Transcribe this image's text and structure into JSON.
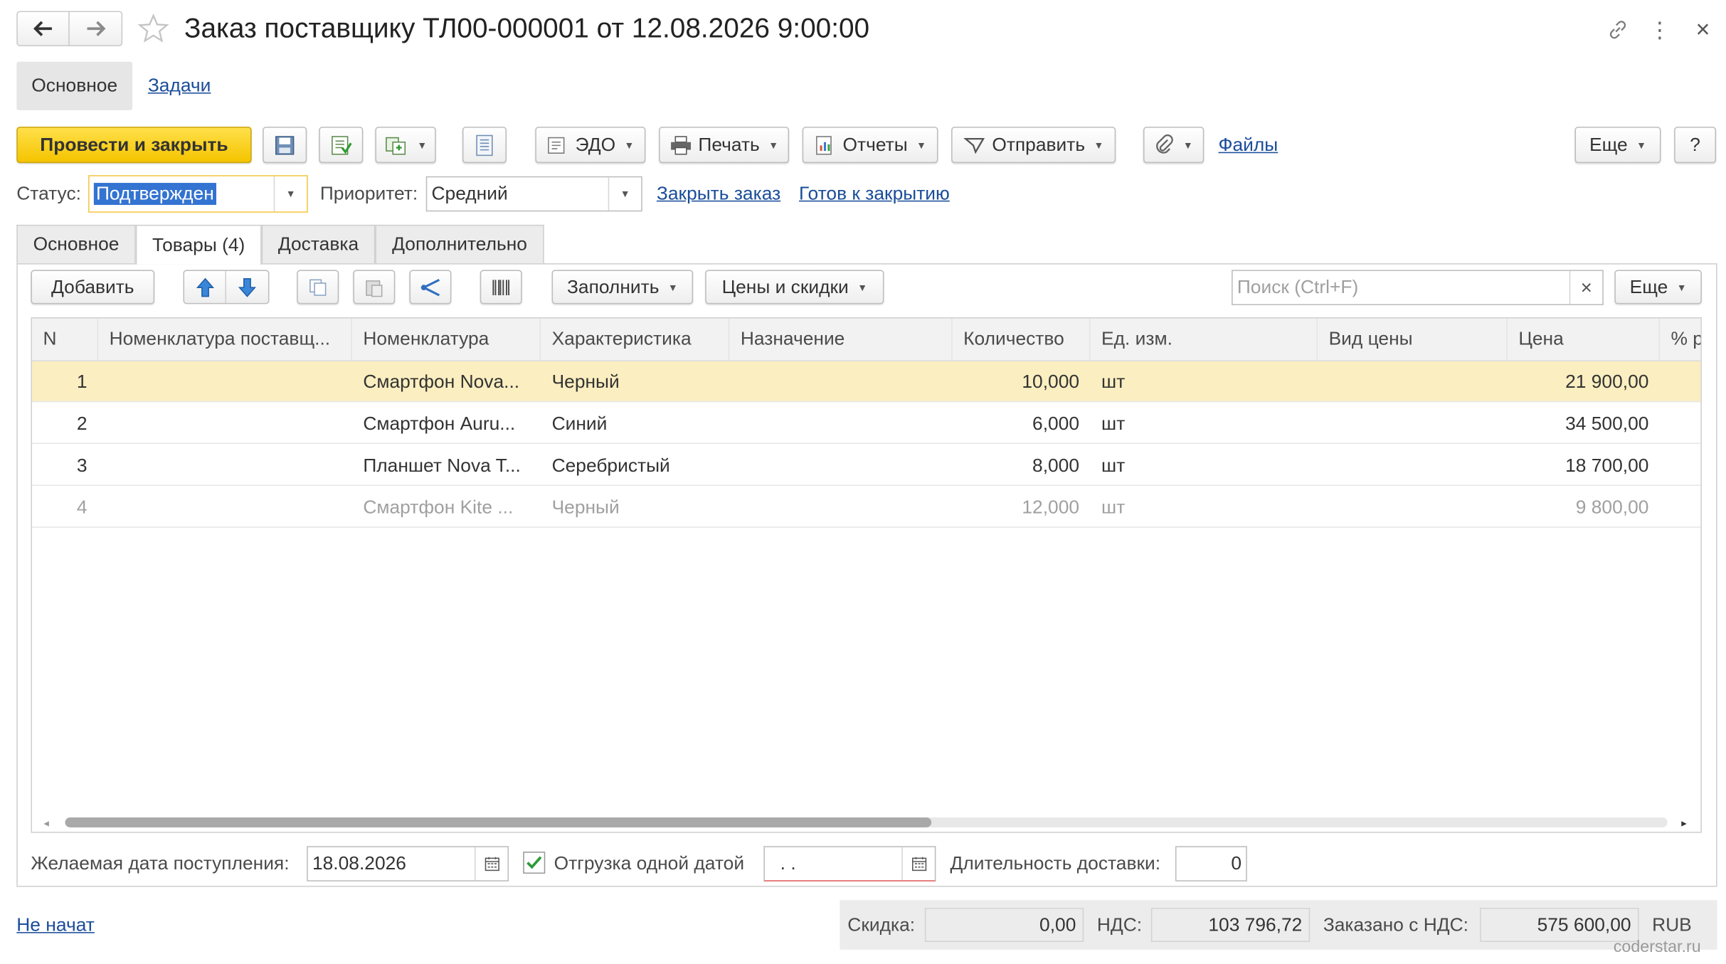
{
  "window": {
    "title": "Заказ поставщику ТЛ00-000001 от 12.08.2026 9:00:00"
  },
  "nav": {
    "main_label": "Основное",
    "tasks_link": "Задачи"
  },
  "toolbar": {
    "post_close_label": "Провести и закрыть",
    "edo_label": "ЭДО",
    "print_label": "Печать",
    "reports_label": "Отчеты",
    "send_label": "Отправить",
    "files_link": "Файлы",
    "more_label": "Еще",
    "help_label": "?"
  },
  "status_bar": {
    "status_label": "Статус:",
    "status_value": "Подтвержден",
    "priority_label": "Приоритет:",
    "priority_value": "Средний",
    "close_order_link": "Закрыть заказ",
    "ready_to_close_link": "Готов к закрытию"
  },
  "tabs": [
    {
      "label": "Основное"
    },
    {
      "label": "Товары (4)"
    },
    {
      "label": "Доставка"
    },
    {
      "label": "Дополнительно"
    }
  ],
  "goods_toolbar": {
    "add_label": "Добавить",
    "fill_label": "Заполнить",
    "prices_label": "Цены и скидки",
    "search_placeholder": "Поиск (Ctrl+F)",
    "search_clear": "×",
    "more_label": "Еще"
  },
  "table": {
    "columns": [
      "N",
      "Номенклатура поставщ...",
      "Номенклатура",
      "Характеристика",
      "Назначение",
      "Количество",
      "Ед. изм.",
      "Вид цены",
      "Цена",
      "% р"
    ],
    "rows": [
      {
        "n": "1",
        "supplier_item": "",
        "item": "Смартфон Nova...",
        "characteristic": "Черный",
        "purpose": "",
        "qty": "10,000",
        "unit": "шт",
        "price_type": "",
        "price": "21 900,00"
      },
      {
        "n": "2",
        "supplier_item": "",
        "item": "Смартфон Auru...",
        "characteristic": "Синий",
        "purpose": "",
        "qty": "6,000",
        "unit": "шт",
        "price_type": "",
        "price": "34 500,00"
      },
      {
        "n": "3",
        "supplier_item": "",
        "item": "Планшет Nova T...",
        "characteristic": "Серебристый",
        "purpose": "",
        "qty": "8,000",
        "unit": "шт",
        "price_type": "",
        "price": "18 700,00"
      },
      {
        "n": "4",
        "supplier_item": "",
        "item": "Смартфон Kite ...",
        "characteristic": "Черный",
        "purpose": "",
        "qty": "12,000",
        "unit": "шт",
        "price_type": "",
        "price": "9 800,00"
      }
    ]
  },
  "delivery": {
    "desired_date_label": "Желаемая дата поступления:",
    "desired_date_value": "18.08.2026",
    "single_date_label": "Отгрузка одной датой",
    "single_date_checked": true,
    "date_value": " .  .",
    "duration_label": "Длительность доставки:",
    "duration_value": "0"
  },
  "footer": {
    "status_link": "Не начат",
    "discount_label": "Скидка:",
    "discount_value": "0,00",
    "vat_label": "НДС:",
    "vat_value": "103 796,72",
    "ordered_label": "Заказано с НДС:",
    "ordered_value": "575 600,00",
    "currency": "RUB",
    "watermark": "coderstar.ru"
  },
  "colors": {
    "primary_button": "#ffd11e",
    "link": "#1a4d9a",
    "selected_row": "#fbeec0",
    "focus_border": "#f4c542"
  }
}
